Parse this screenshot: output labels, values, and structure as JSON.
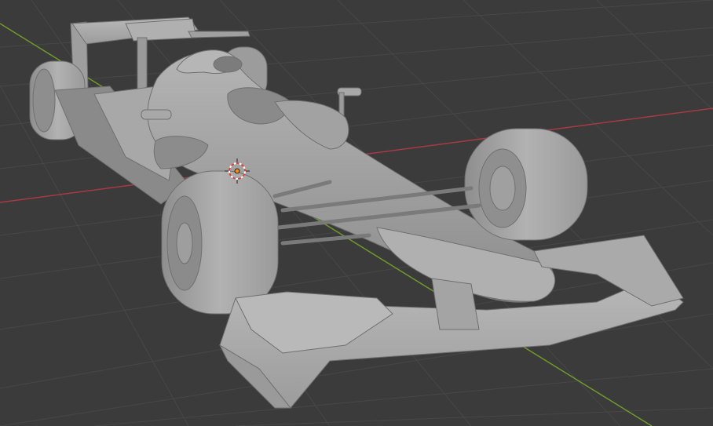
{
  "viewport": {
    "background": "#3b3b3b",
    "grid_color": "#4a4a4a",
    "x_axis_color": "#a83a44",
    "y_axis_color": "#6e9a2a",
    "model_color": "#a6a6a6",
    "shading": "solid",
    "object": "formula-1-car-mesh"
  },
  "cursor": {
    "icon": "3d-cursor-icon",
    "ring_color": "#d9453c"
  },
  "origin": {
    "icon": "object-origin-icon",
    "color": "#f08a1a"
  }
}
